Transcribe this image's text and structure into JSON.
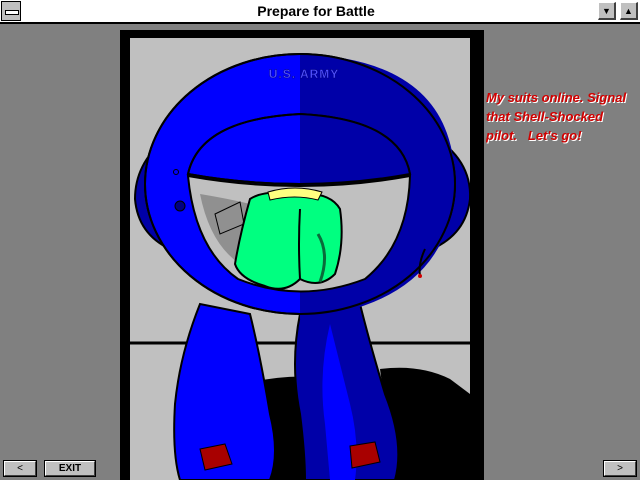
{
  "window": {
    "title": "Prepare for Battle",
    "minimize_glyph": "▼",
    "maximize_glyph": "▲"
  },
  "scene": {
    "suit_insignia": "U.S. ARMY",
    "caption": "My suits online. Signal\nthat Shell-Shocked\npilot.   Let's go!"
  },
  "controls": {
    "prev_label": "<",
    "exit_label": "EXIT",
    "next_label": ">"
  },
  "colors": {
    "background": "#808080",
    "suit_blue": "#0000ff",
    "suit_dark_blue": "#0000a8",
    "pilot_green": "#00ff80",
    "caption_red": "#d00000"
  }
}
